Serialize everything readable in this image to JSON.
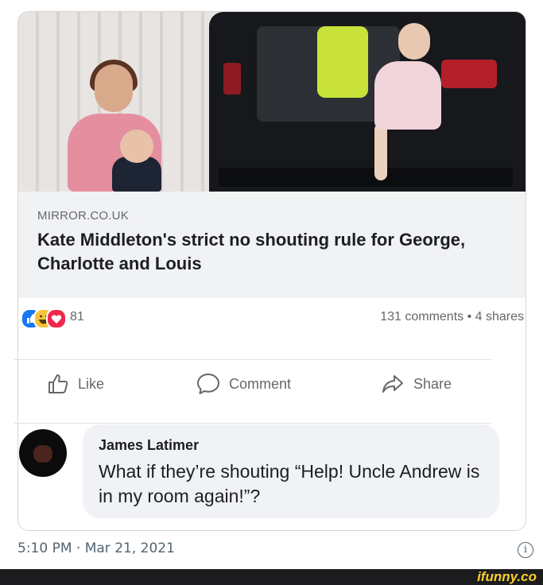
{
  "link_preview": {
    "domain": "MIRROR.CO.UK",
    "headline": "Kate Middleton's strict no shouting rule for George, Charlotte and Louis"
  },
  "reactions": {
    "icons": [
      "like-icon",
      "haha-icon",
      "love-icon"
    ],
    "count": "81"
  },
  "post_meta": "131 comments • 4 shares",
  "actions": {
    "like": "Like",
    "comment": "Comment",
    "share": "Share"
  },
  "comment": {
    "author": "James Latimer",
    "text": "What if they’re shouting “Help! Uncle Andrew is in my room again!”?"
  },
  "footer": {
    "timestamp": "5:10 PM · Mar 21, 2021"
  },
  "watermark": "ifunny.co",
  "colors": {
    "like_blue": "#1877f2",
    "haha_yellow": "#f7c23c",
    "love_red": "#f0284a",
    "muted_text": "#65676b",
    "ifunny_yellow": "#f8cf2a"
  }
}
